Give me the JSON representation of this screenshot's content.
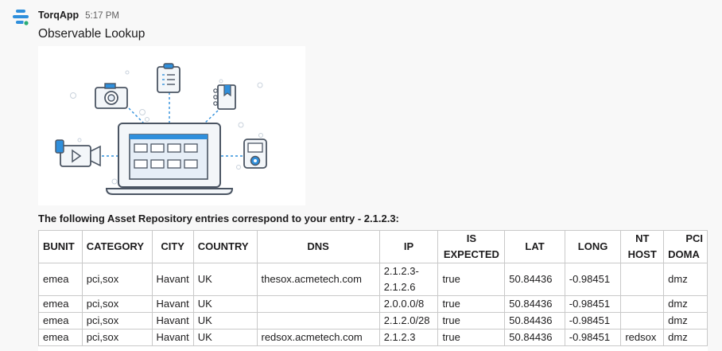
{
  "message": {
    "sender": "TorqApp",
    "time": "5:17 PM",
    "title": "Observable Lookup",
    "intro": "The following Asset Repository entries correspond to your entry - 2.1.2.3:"
  },
  "colors": {
    "accent_blue": "#2f8fdc",
    "online_green": "#2bac76",
    "outline": "#4b5563"
  },
  "table": {
    "headers": [
      {
        "key": "bunit",
        "label": "BUNIT"
      },
      {
        "key": "category",
        "label": "CATEGORY"
      },
      {
        "key": "city",
        "label": "CITY"
      },
      {
        "key": "country",
        "label": "COUNTRY"
      },
      {
        "key": "dns",
        "label": "DNS"
      },
      {
        "key": "ip",
        "label": "IP"
      },
      {
        "key": "is_expected_1",
        "label": "IS"
      },
      {
        "key": "is_expected_2",
        "label": "EXPECTED"
      },
      {
        "key": "lat",
        "label": "LAT"
      },
      {
        "key": "long",
        "label": "LONG"
      },
      {
        "key": "nt_host_1",
        "label": "NT"
      },
      {
        "key": "nt_host_2",
        "label": "HOST"
      },
      {
        "key": "pci_1",
        "label": "PCI"
      },
      {
        "key": "pci_2",
        "label": "DOMA"
      }
    ],
    "rows": [
      {
        "bunit": "emea",
        "category": "pci,sox",
        "city": "Havant",
        "country": "UK",
        "dns": "thesox.acmetech.com",
        "ip_line1": "2.1.2.3-",
        "ip_line2": "2.1.2.6",
        "is_expected": "true",
        "lat": "50.84436",
        "long": "-0.98451",
        "nt_host": "",
        "pci_domain": "dmz"
      },
      {
        "bunit": "emea",
        "category": "pci,sox",
        "city": "Havant",
        "country": "UK",
        "dns": "",
        "ip": "2.0.0.0/8",
        "is_expected": "true",
        "lat": "50.84436",
        "long": "-0.98451",
        "nt_host": "",
        "pci_domain": "dmz"
      },
      {
        "bunit": "emea",
        "category": "pci,sox",
        "city": "Havant",
        "country": "UK",
        "dns": "",
        "ip": "2.1.2.0/28",
        "is_expected": "true",
        "lat": "50.84436",
        "long": "-0.98451",
        "nt_host": "",
        "pci_domain": "dmz"
      },
      {
        "bunit": "emea",
        "category": "pci,sox",
        "city": "Havant",
        "country": "UK",
        "dns": "redsox.acmetech.com",
        "ip": "2.1.2.3",
        "is_expected": "true",
        "lat": "50.84436",
        "long": "-0.98451",
        "nt_host": "redsox",
        "pci_domain": "dmz"
      }
    ]
  }
}
